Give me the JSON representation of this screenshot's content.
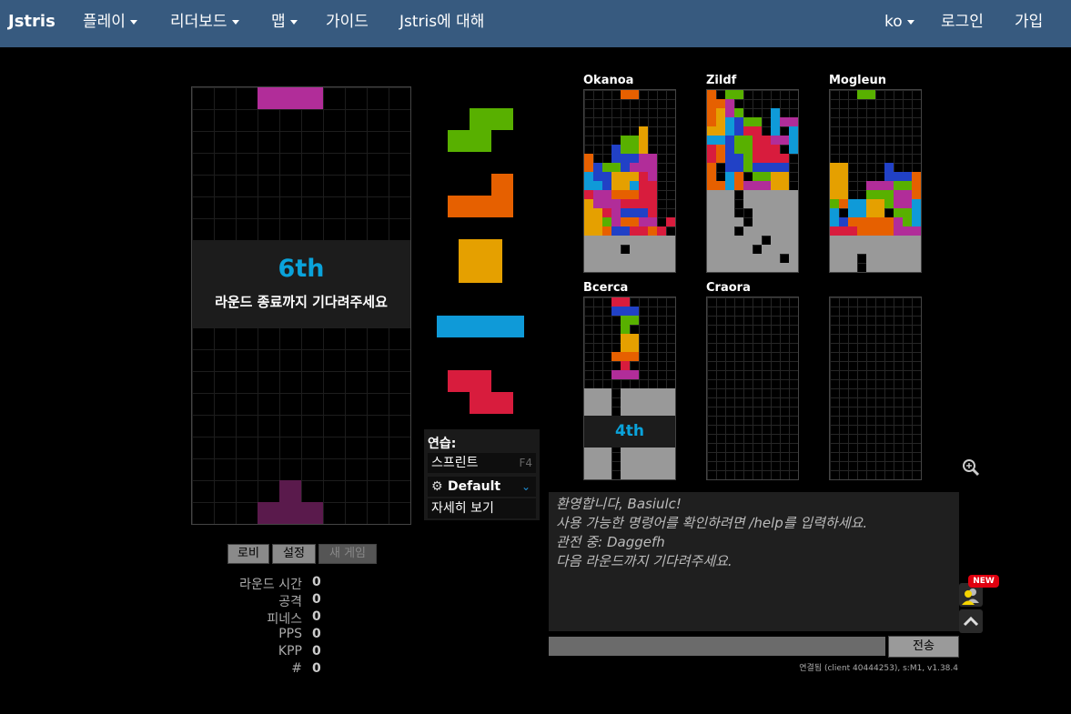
{
  "navbar": {
    "brand": "Jstris",
    "items": [
      "플레이",
      "리더보드",
      "맵",
      "가이드",
      "Jstris에 대해"
    ],
    "lang": "ko",
    "login": "로그인",
    "signup": "가입"
  },
  "colors": {
    "nav_bg": "#375a7f",
    "T": "#b12d99",
    "S": "#58b000",
    "L": "#e66000",
    "O": "#e5a000",
    "I": "#0f9ad8",
    "Z": "#d81c3d",
    "J": "#2141c6",
    "G": "#999999",
    "ghost": "#5a1a4c",
    "accent": "#0aa3db"
  },
  "main_board": {
    "placement": "6th",
    "waiting_text": "라운드 종료까지 기다려주세요"
  },
  "queue": [
    "S",
    "L",
    "O",
    "I",
    "Z"
  ],
  "practice": {
    "title": "연습:",
    "mode": "스프린트",
    "mode_key": "F4",
    "skin": "Default",
    "details": "자세히 보기"
  },
  "buttons": {
    "lobby": "로비",
    "settings": "설정",
    "new_game": "새 게임"
  },
  "stats": [
    {
      "label": "라운드 시간",
      "value": "0"
    },
    {
      "label": "공격",
      "value": "0"
    },
    {
      "label": "피네스",
      "value": "0"
    },
    {
      "label": "PPS",
      "value": "0"
    },
    {
      "label": "KPP",
      "value": "0"
    },
    {
      "label": "#",
      "value": "0"
    }
  ],
  "opponents": [
    {
      "name": "Okanoa",
      "status": ""
    },
    {
      "name": "Zildf",
      "status": ""
    },
    {
      "name": "Mogleun",
      "status": ""
    },
    {
      "name": "Bcerca",
      "status": "4th"
    },
    {
      "name": "Craora",
      "status": ""
    },
    {
      "name": "",
      "status": ""
    }
  ],
  "chat": {
    "lines": [
      "환영합니다, Basiulc!",
      "사용 가능한 명령어를 확인하려면 /help를 입력하세요.",
      "관전 중: Daggefh",
      "다음 라운드까지 기다려주세요."
    ],
    "input_value": "",
    "send": "전송",
    "status": "연결됨 (client 40444253), s:M1, v1.38.4"
  },
  "badge": "NEW"
}
